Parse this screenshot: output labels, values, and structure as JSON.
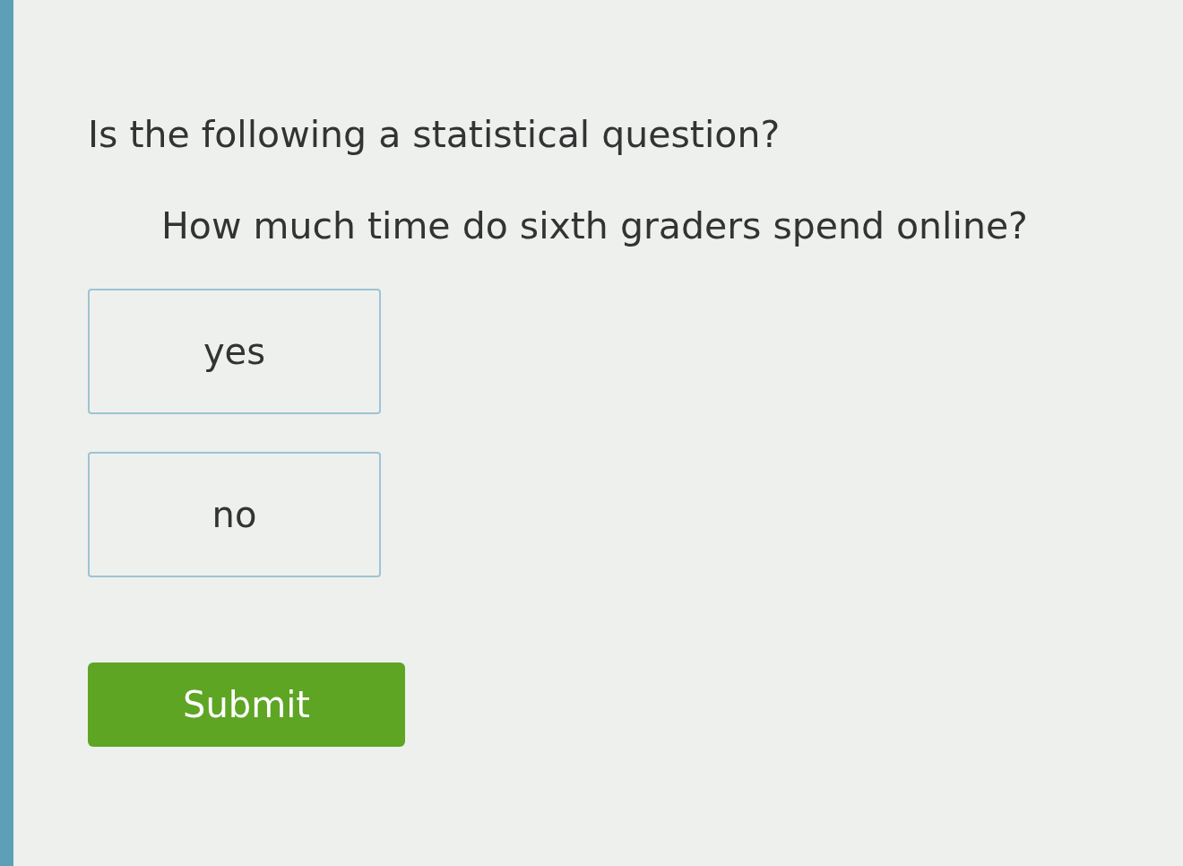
{
  "question": {
    "prompt": "Is the following a statistical question?",
    "statement": "How much time do sixth graders spend online?"
  },
  "choices": [
    {
      "label": "yes",
      "selected": false
    },
    {
      "label": "no",
      "selected": false
    }
  ],
  "submit_button": {
    "label": "Submit"
  }
}
